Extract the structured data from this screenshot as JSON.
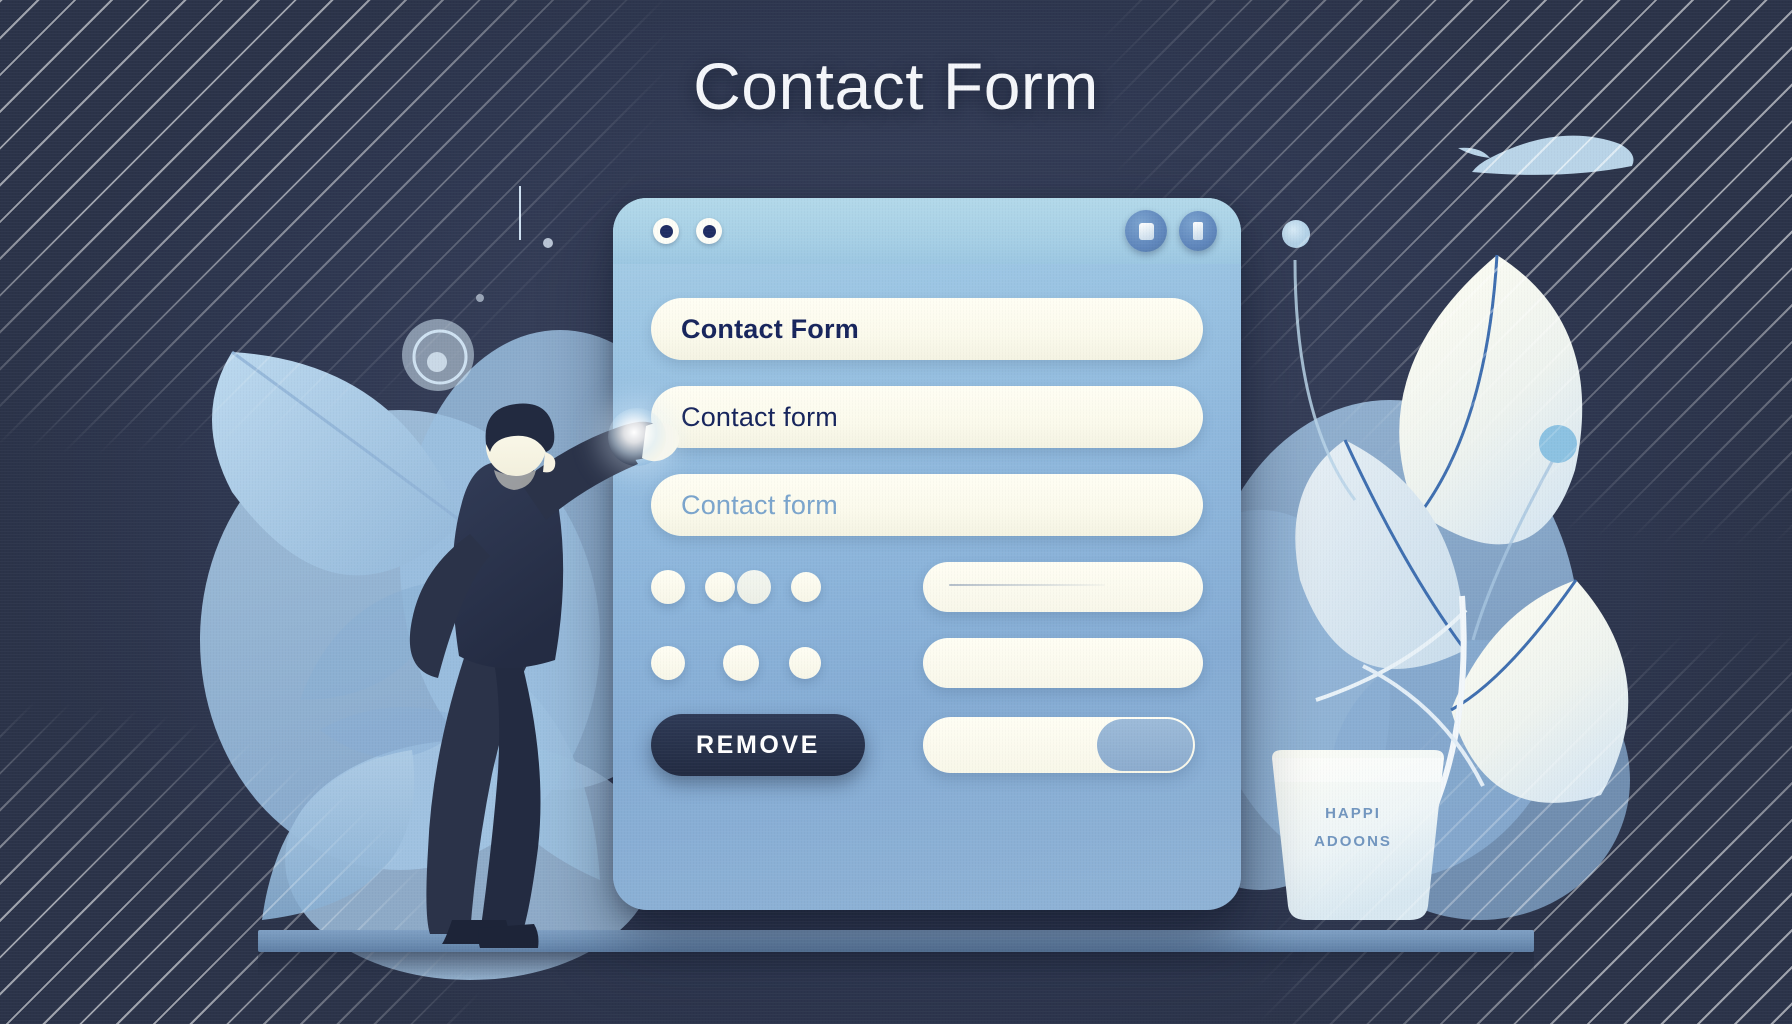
{
  "headline": {
    "text": "Contact Form"
  },
  "window": {
    "traffic_dots": [
      {
        "name": "window-dot-1"
      },
      {
        "name": "window-dot-2"
      }
    ],
    "actions": [
      {
        "name": "window-copy-button",
        "icon": "copy-icon"
      },
      {
        "name": "window-document-button",
        "icon": "document-icon"
      }
    ]
  },
  "form": {
    "fields": [
      {
        "value": "Contact Form",
        "style": "filled-bold",
        "color": "#17255c"
      },
      {
        "value": "Contact form",
        "style": "filled",
        "color": "#16245c"
      },
      {
        "value": "Contact form",
        "style": "placeholder",
        "color": "#7ba5cd"
      }
    ],
    "option_rows": [
      {
        "circles": [
          30,
          26,
          30,
          26
        ],
        "pill": {
          "has_hairline": true
        }
      },
      {
        "circles": [
          30,
          30,
          26
        ],
        "pill": {
          "has_hairline": false
        }
      }
    ],
    "remove_button": {
      "label": "REMOVE"
    },
    "toggle": {
      "state": "on",
      "knob_position": "right"
    }
  },
  "decor": {
    "pot_label_line1": "HAPPI",
    "pot_label_line2": "ADOONS",
    "touch_indicator": "touch-glow-indicator"
  },
  "colors": {
    "background_dark": "#2f3850",
    "card_top": "#a9cfe6",
    "card_bottom": "#85acd4",
    "titlebar": "#a7d0e6",
    "field_cream": "#fffef4",
    "accent_navy": "#17255c",
    "remove_button": "#27314a",
    "leaf_light": "#a9c9e4",
    "leaf_cream": "#f2f4e8",
    "shelf": "#6e8fb4",
    "stripe": "#ffffff"
  }
}
